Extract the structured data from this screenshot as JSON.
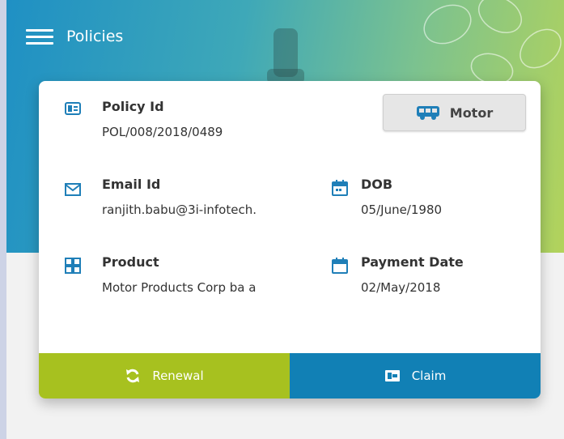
{
  "header": {
    "title": "Policies"
  },
  "card": {
    "policy_id": {
      "label": "Policy Id",
      "value": "POL/008/2018/0489"
    },
    "motor_button": {
      "label": "Motor"
    },
    "email": {
      "label": "Email Id",
      "value": "ranjith.babu@3i-infotech."
    },
    "dob": {
      "label": "DOB",
      "value": "05/June/1980"
    },
    "product": {
      "label": "Product",
      "value": "Motor Products Corp ba a"
    },
    "payment_date": {
      "label": "Payment Date",
      "value": "02/May/2018"
    },
    "actions": {
      "renewal": "Renewal",
      "claim": "Claim"
    }
  },
  "colors": {
    "accent_blue": "#1f7fb8",
    "renewal_green": "#a7c11f",
    "claim_blue": "#1180b5",
    "icon_blue": "#1f7fb8"
  },
  "icons": {
    "menu": "hamburger-icon",
    "policy_id": "id-card-icon",
    "motor": "bus-icon",
    "email": "envelope-icon",
    "dob": "calendar-icon",
    "product": "grid-icon",
    "payment_date": "calendar-icon",
    "renewal": "refresh-icon",
    "claim": "wallet-icon"
  }
}
